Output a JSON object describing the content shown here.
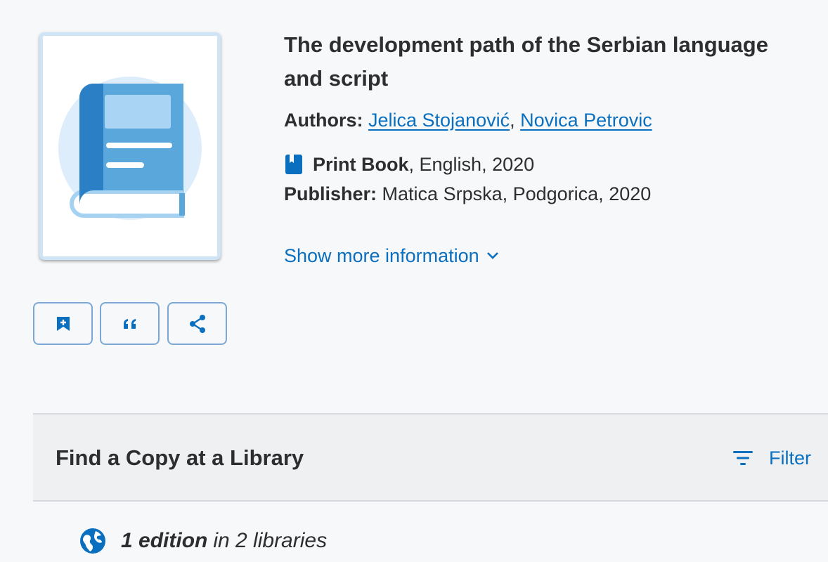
{
  "book": {
    "title": "The development path of the Serbian language and script",
    "authors_label": "Authors:",
    "authors": [
      {
        "name": "Jelica Stojanović"
      },
      {
        "name": "Novica Petrovic"
      }
    ],
    "author_separator": ",",
    "format_icon": "book-icon",
    "format": "Print Book",
    "format_details": ", English, 2020",
    "publisher_label": "Publisher:",
    "publisher": "Matica Srpska, Podgorica, 2020",
    "show_more": "Show more information",
    "cover_icon": "book-illustration-icon"
  },
  "actions": {
    "save_icon": "bookmark-add-icon",
    "cite_icon": "quote-icon",
    "share_icon": "share-icon"
  },
  "find_copy": {
    "title": "Find a Copy at a Library",
    "filter_label": "Filter",
    "filter_icon": "filter-icon",
    "editions_icon": "globe-icon",
    "edition_count": "1 edition",
    "edition_rest": "in 2 libraries"
  },
  "colors": {
    "link": "#0b6fbf",
    "text": "#2d2e2f",
    "background": "#f7f8f9",
    "section_bg": "#eef0f2",
    "button_border": "#7aa7d6"
  }
}
